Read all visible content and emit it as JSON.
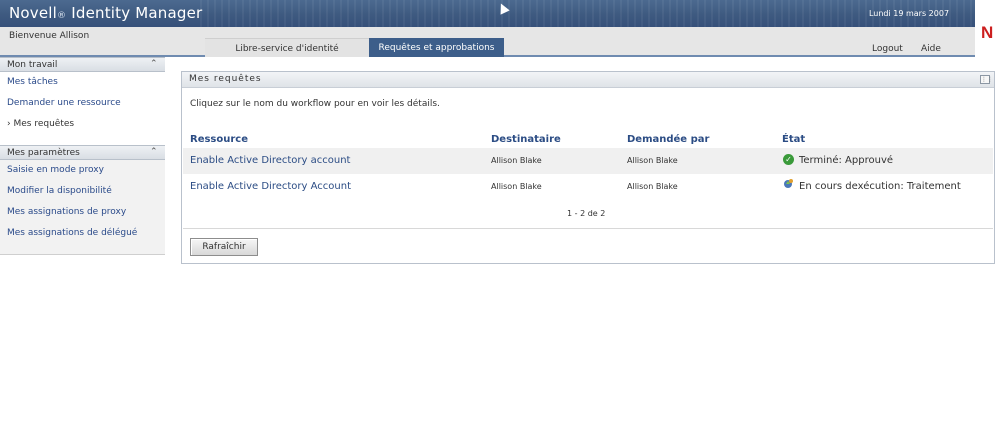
{
  "header": {
    "brand": "Novell",
    "reg_mark": "®",
    "product": "Identity Manager",
    "date": "Lundi 19 mars 2007",
    "logo_letter": "N"
  },
  "nav": {
    "welcome": "Bienvenue Allison",
    "tabs": [
      {
        "label": "Libre-service d'identité",
        "active": false
      },
      {
        "label": "Requêtes et approbations",
        "active": true
      }
    ],
    "logout": "Logout",
    "help": "Aide"
  },
  "sidebar": {
    "groups": [
      {
        "title": "Mon travail",
        "collapse_icon": "double-chevron-up",
        "items": [
          "Mes tâches",
          "Demander une ressource",
          "Mes requêtes"
        ],
        "current": "Mes requêtes"
      },
      {
        "title": "Mes paramètres",
        "collapse_icon": "double-chevron-up",
        "items": [
          "Saisie en mode proxy",
          "Modifier la disponibilité",
          "Mes assignations de proxy",
          "Mes assignations de délégué"
        ]
      }
    ]
  },
  "main": {
    "title": "Mes requêtes",
    "instruction": "Cliquez sur le nom du workflow pour en voir les détails.",
    "columns": [
      "Ressource",
      "Destinataire",
      "Demandée par",
      "État"
    ],
    "rows": [
      {
        "resource": "Enable Active Directory account",
        "recipient": "Allison Blake",
        "requested_by": "Allison Blake",
        "status": "Terminé: Approuvé",
        "status_icon": "check-circle-icon"
      },
      {
        "resource": "Enable Active Directory Account",
        "recipient": "Allison Blake",
        "requested_by": "Allison Blake",
        "status": "En cours dexécution: Traitement",
        "status_icon": "running-process-icon"
      }
    ],
    "pagination": "1 - 2 de 2",
    "refresh_label": "Rafraîchir"
  },
  "colors": {
    "banner": "#3e5a80",
    "active_tab": "#3d5e8a",
    "link": "#2b4c84",
    "logo_red": "#cc1f1f",
    "ok_green": "#3a9a3a"
  }
}
